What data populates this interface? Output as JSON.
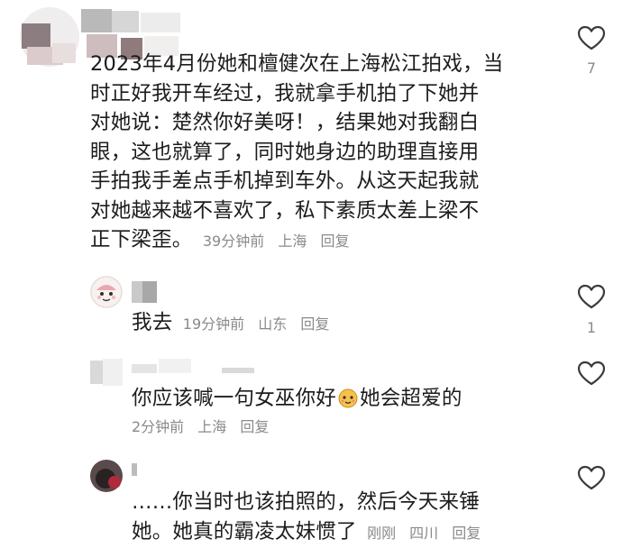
{
  "comments": [
    {
      "text_lines": [
        "2023年4月份她和檀健次在上海松江拍戏，当",
        "时正好我开车经过，我就拿手机拍了下她并",
        "对她说：楚然你好美呀！，结果她对我翻白",
        "眼，这也就算了，同时她身边的助理直接用",
        "手拍我手差点手机掉到车外。从这天起我就",
        "对她越来越不喜欢了，私下素质太差上梁不",
        "正下梁歪。"
      ],
      "time": "39分钟前",
      "location": "上海",
      "reply": "回复",
      "likes": "7"
    },
    {
      "text": "我去",
      "time": "19分钟前",
      "location": "山东",
      "reply": "回复",
      "likes": "1"
    },
    {
      "text_before": "你应该喊一句女巫你好",
      "emoji": "cookie-face-emoji-icon",
      "text_after": "她会超爱的",
      "time": "2分钟前",
      "location": "上海",
      "reply": "回复",
      "likes": ""
    },
    {
      "text_lines": [
        "……你当时也该拍照的，然后今天来锤",
        "她。她真的霸凌太妹惯了"
      ],
      "time": "刚刚",
      "location": "四川",
      "reply": "回复",
      "likes": ""
    }
  ],
  "colors": {
    "text": "#1c1c1c",
    "meta": "#8a8a8a",
    "heart_outline": "#3a3a3a"
  }
}
